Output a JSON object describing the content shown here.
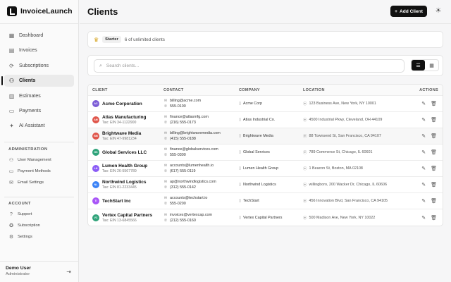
{
  "app": {
    "name": "InvoiceLaunch"
  },
  "sidebar": {
    "items": [
      {
        "label": "Dashboard",
        "icon": "grid-icon",
        "glyph": "▦"
      },
      {
        "label": "Invoices",
        "icon": "file-icon",
        "glyph": "▤"
      },
      {
        "label": "Subscriptions",
        "icon": "refresh-icon",
        "glyph": "⟳"
      },
      {
        "label": "Clients",
        "icon": "users-icon",
        "glyph": "⚇",
        "active": true
      },
      {
        "label": "Estimates",
        "icon": "file-text-icon",
        "glyph": "▥"
      },
      {
        "label": "Payments",
        "icon": "credit-card-icon",
        "glyph": "▭"
      },
      {
        "label": "AI Assistant",
        "icon": "sparkle-icon",
        "glyph": "✦"
      }
    ],
    "admin_title": "ADMINISTRATION",
    "admin_items": [
      {
        "label": "User Management",
        "icon": "user-cog-icon",
        "glyph": "⚇"
      },
      {
        "label": "Payment Methods",
        "icon": "card-icon",
        "glyph": "▭"
      },
      {
        "label": "Email Settings",
        "icon": "mail-icon",
        "glyph": "✉"
      }
    ],
    "account_title": "ACCOUNT",
    "account_items": [
      {
        "label": "Support",
        "icon": "help-icon",
        "glyph": "?"
      },
      {
        "label": "Subscription",
        "icon": "badge-icon",
        "glyph": "✪"
      },
      {
        "label": "Settings",
        "icon": "gear-icon",
        "glyph": "⚙"
      }
    ],
    "user": {
      "name": "Demo User",
      "role": "Administrator"
    }
  },
  "header": {
    "title": "Clients",
    "add_label": "Add Client"
  },
  "plan": {
    "badge": "Starter",
    "text": "6 of unlimited clients"
  },
  "search": {
    "placeholder": "Search clients..."
  },
  "table": {
    "columns": {
      "client": "CLIENT",
      "contact": "CONTACT",
      "company": "COMPANY",
      "location": "LOCATION",
      "actions": "ACTIONS"
    },
    "rows": [
      {
        "initials": "AC",
        "color": "#7c5cd6",
        "name": "Acme Corporation",
        "tax": "",
        "email": "billing@acme.com",
        "phone": "555-0100",
        "company": "Acme Corp",
        "location": "123 Business Ave, New York, NY 10001"
      },
      {
        "initials": "AM",
        "color": "#e0564b",
        "name": "Atlas Manufacturing",
        "tax": "Tax: EIN 34-1122900",
        "email": "finance@atlasmfg.com",
        "phone": "(216) 555-0173",
        "company": "Atlas Industrial Co.",
        "location": "4500 Industrial Pkwy, Cleveland, OH 44109"
      },
      {
        "initials": "BM",
        "color": "#e0564b",
        "name": "Brightwave Media",
        "tax": "Tax: EIN 47-9981234",
        "email": "billing@brightwavemedia.com",
        "phone": "(415) 555-0188",
        "company": "Brightwave Media",
        "location": "88 Townsend St, San Francisco, CA 94107"
      },
      {
        "initials": "GS",
        "color": "#2fa37a",
        "name": "Global Services LLC",
        "tax": "",
        "email": "finance@globalservices.com",
        "phone": "555-0300",
        "company": "Global Services",
        "location": "789 Commerce St, Chicago, IL 60601"
      },
      {
        "initials": "LH",
        "color": "#8b5cf6",
        "name": "Lumen Health Group",
        "tax": "Tax: EIN 26-5567789",
        "email": "accounts@lumenhealth.io",
        "phone": "(617) 555-0119",
        "company": "Lumen Health Group",
        "location": "1 Beacon St, Boston, MA 02108"
      },
      {
        "initials": "NL",
        "color": "#3b82f6",
        "name": "Northwind Logistics",
        "tax": "Tax: EIN 81-2233445",
        "email": "ap@northwindlogistics.com",
        "phone": "(312) 555-0142",
        "company": "Northwind Logistics",
        "location": "willingboro, 200 Wacker Dr, Chicago, IL 60606"
      },
      {
        "initials": "TI",
        "color": "#a855f7",
        "name": "TechStart Inc",
        "tax": "",
        "email": "accounts@techstart.io",
        "phone": "555-0200",
        "company": "TechStart",
        "location": "456 Innovation Blvd, San Francisco, CA 94105"
      },
      {
        "initials": "VC",
        "color": "#2fa37a",
        "name": "Vertex Capital Partners",
        "tax": "Tax: EIN 13-6845566",
        "email": "invoices@vertexcap.com",
        "phone": "(212) 555-0160",
        "company": "Vertex Capital Partners",
        "location": "500 Madison Ave, New York, NY 10022"
      }
    ]
  }
}
